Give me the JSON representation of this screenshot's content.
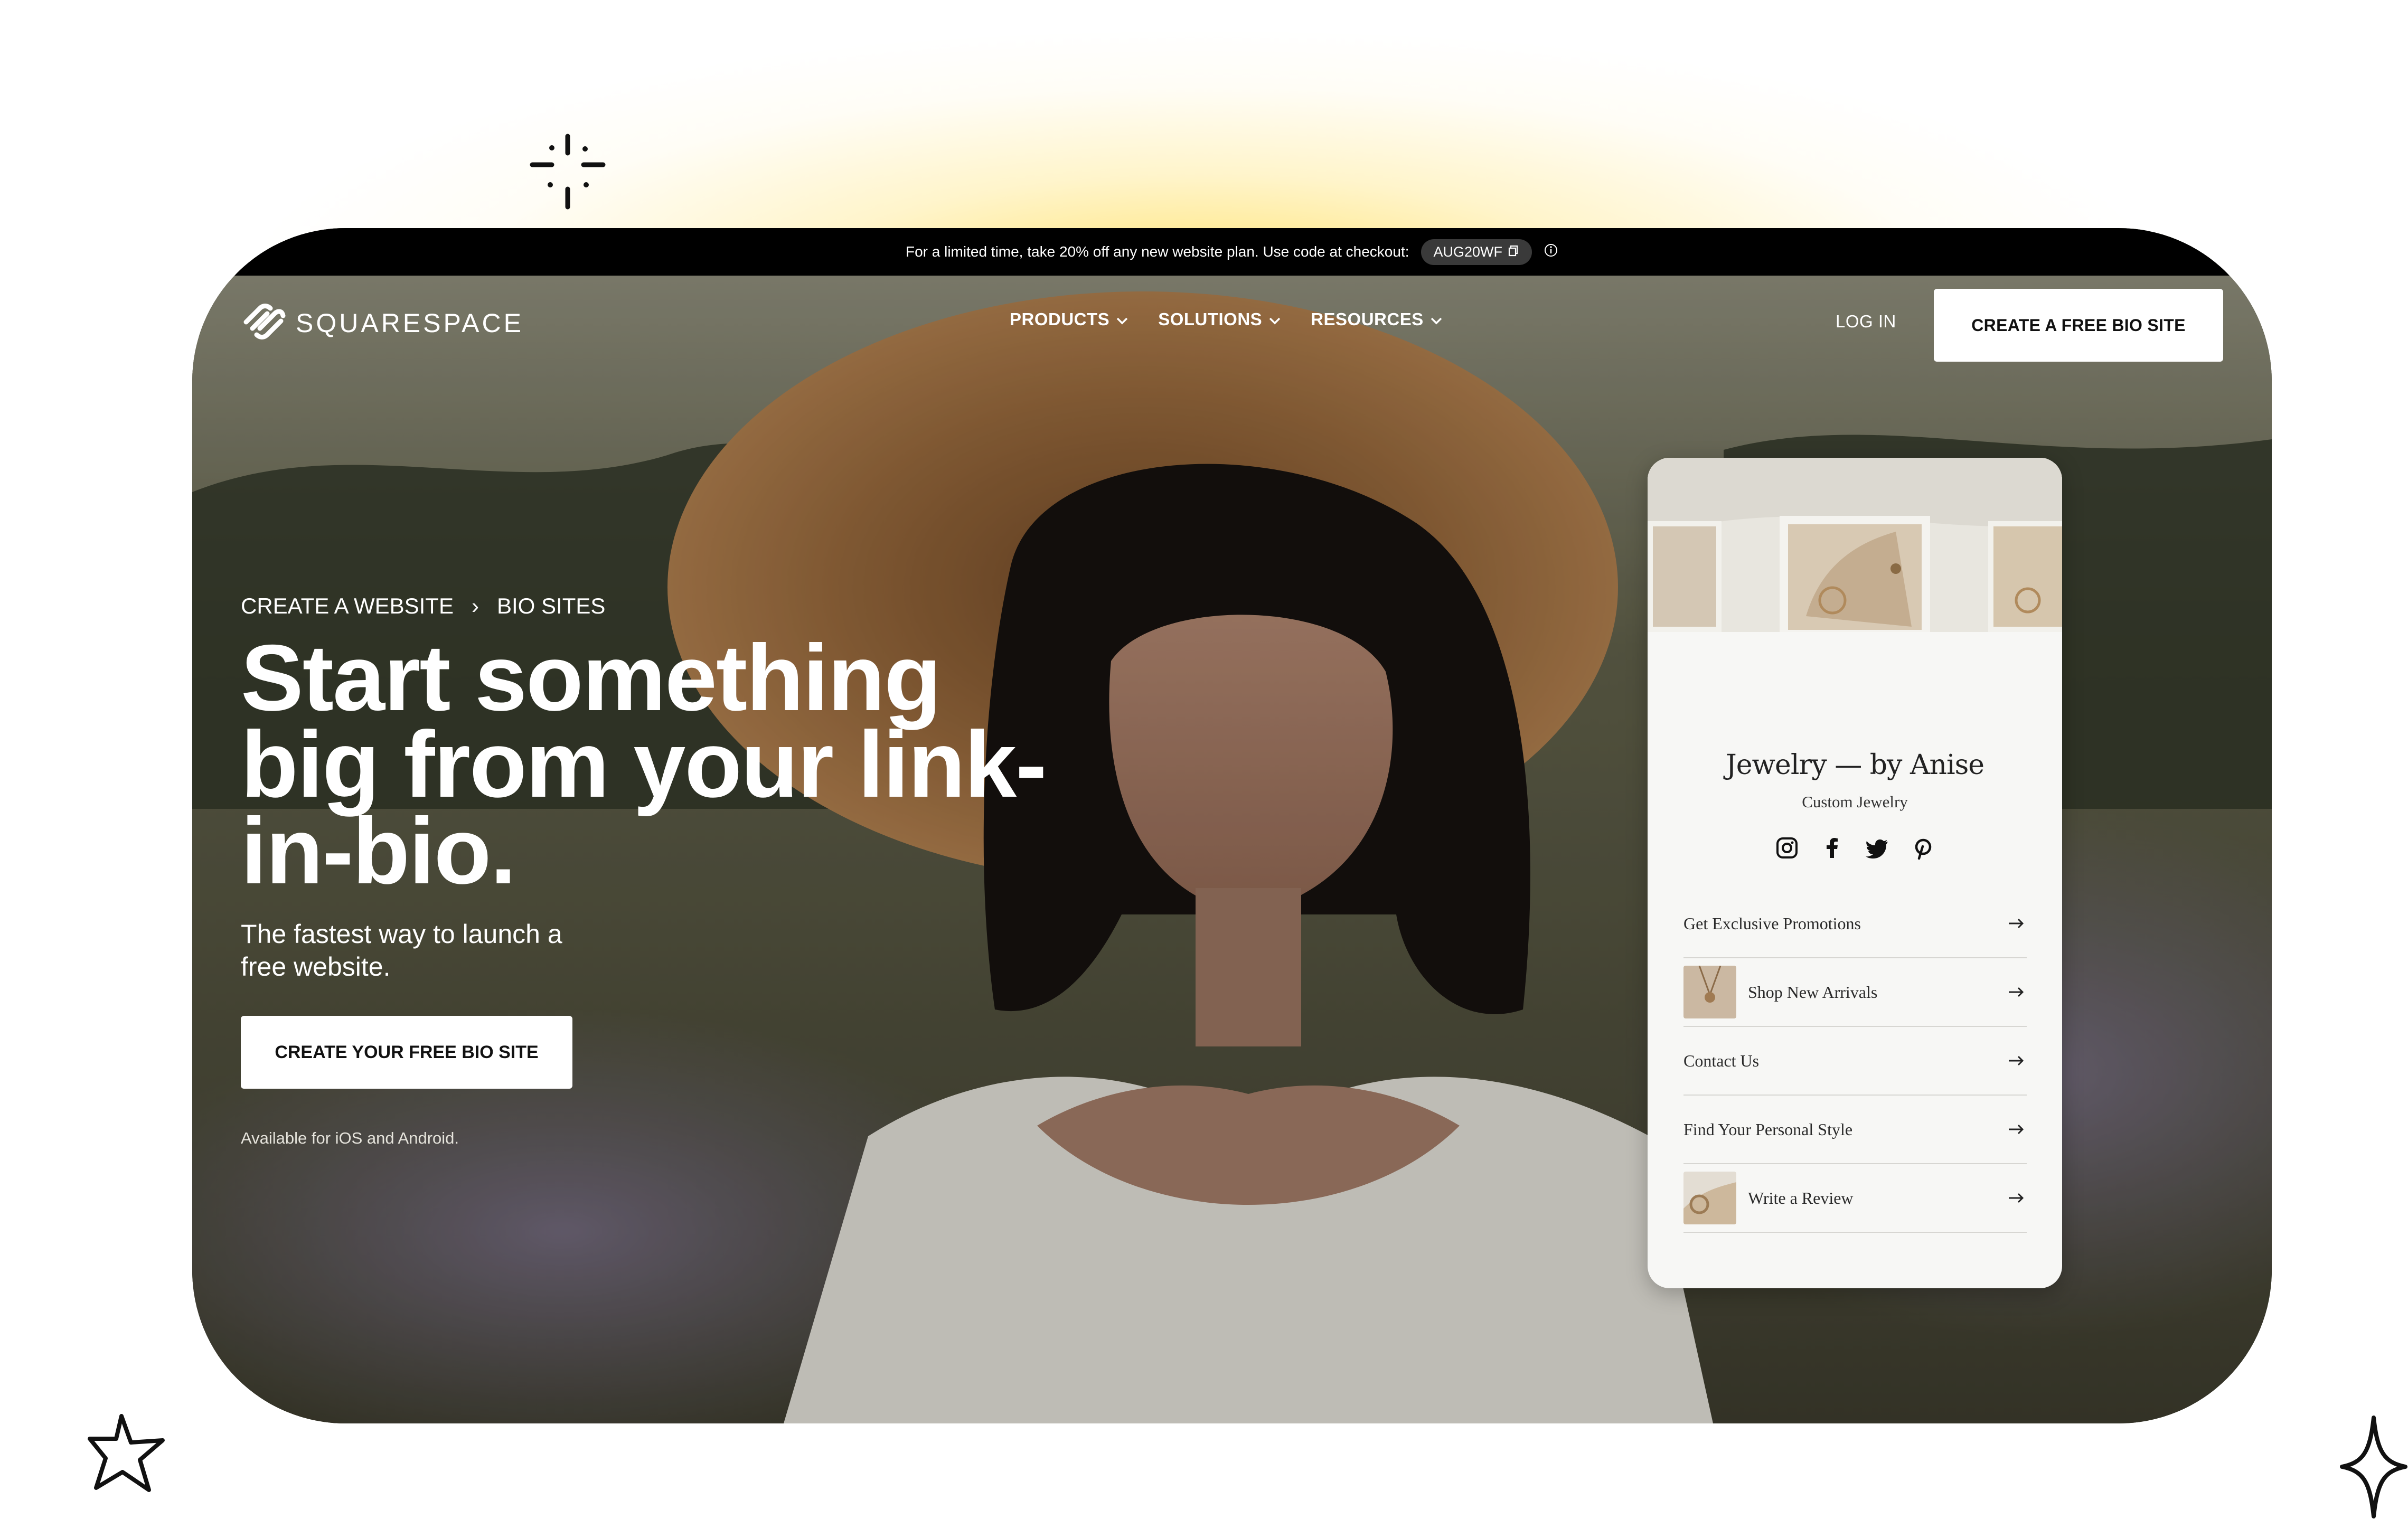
{
  "announcement": {
    "text": "For a limited time, take 20% off any new website plan. Use code at checkout:",
    "code": "AUG20WF",
    "close": "×"
  },
  "nav": {
    "brand": "SQUARESPACE",
    "links": [
      {
        "label": "PRODUCTS"
      },
      {
        "label": "SOLUTIONS"
      },
      {
        "label": "RESOURCES"
      }
    ],
    "login": "LOG IN",
    "cta": "CREATE A FREE BIO SITE"
  },
  "breadcrumb": {
    "items": [
      "CREATE A WEBSITE",
      "BIO SITES"
    ],
    "separator": "›"
  },
  "hero": {
    "title": "Start something big from your link-in-bio.",
    "subtitle": "The fastest way to launch a free website.",
    "cta": "CREATE YOUR FREE BIO SITE",
    "availability": "Available for iOS and Android."
  },
  "bio_preview": {
    "title": "Jewelry — by Anise",
    "subtitle": "Custom Jewelry",
    "socials": [
      "instagram-icon",
      "facebook-icon",
      "twitter-icon",
      "pinterest-icon"
    ],
    "links": [
      {
        "label": "Get Exclusive Promotions",
        "thumb": false
      },
      {
        "label": "Shop New Arrivals",
        "thumb": true
      },
      {
        "label": "Contact Us",
        "thumb": false
      },
      {
        "label": "Find Your Personal Style",
        "thumb": false
      },
      {
        "label": "Write a Review",
        "thumb": true
      }
    ]
  },
  "colors": {
    "announcement_bg": "#000000",
    "button_bg": "#ffffff",
    "glow": "#ffe26e"
  }
}
